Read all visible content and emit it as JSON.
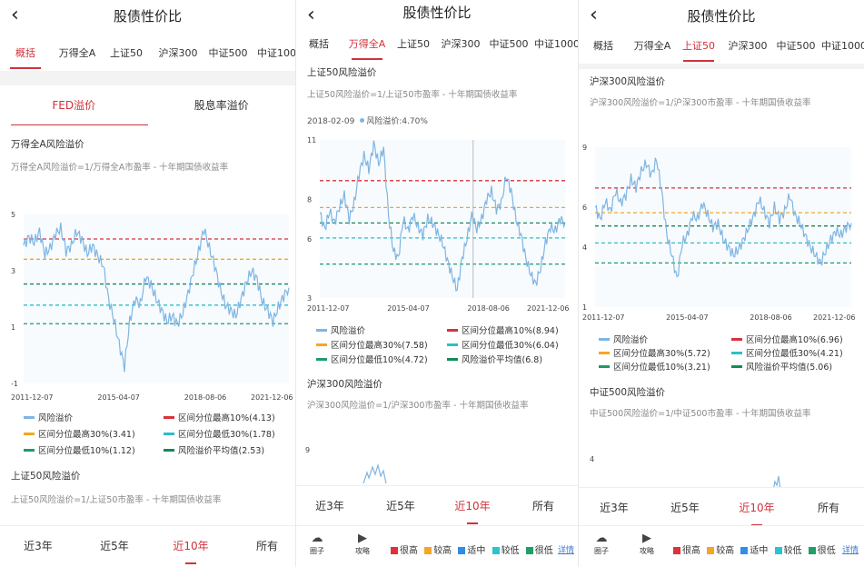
{
  "colors": {
    "accent": "#d0323c",
    "series": "#7fb5e3",
    "line_max10": "#d9323c",
    "line_max30": "#f5a623",
    "line_min30": "#2bbfc6",
    "line_min10": "#1f9a6b",
    "line_avg": "#138a5a",
    "level_very_high": "#e0303c",
    "level_high": "#f5a623",
    "level_mid": "#2f8ee6",
    "level_low": "#29c4cc",
    "level_very_low": "#1fa065",
    "link": "#3a78d6"
  },
  "header": {
    "back_icon": "chevron-left-icon",
    "title": "股债性价比"
  },
  "tabs": [
    "概括",
    "万得全A",
    "上证50",
    "沪深300",
    "中证500",
    "中证1000"
  ],
  "range_tabs": [
    "近3年",
    "近5年",
    "近10年",
    "所有"
  ],
  "panel1": {
    "active_tab": "概括",
    "subtabs": [
      "FED溢价",
      "股息率溢价"
    ],
    "section_title": "万得全A风险溢价",
    "formula": "万得全A风险溢价=1/万得全A市盈率 - 十年期国债收益率",
    "legend": [
      "风险溢价",
      "区间分位最高10%(4.13)",
      "区间分位最高30%(3.41)",
      "区间分位最低30%(1.78)",
      "区间分位最低10%(1.12)",
      "风险溢价平均值(2.53)"
    ],
    "next_section_title": "上证50风险溢价",
    "next_formula": "上证50风险溢价=1/上证50市盈率 - 十年期国债收益率",
    "active_range": "近10年"
  },
  "panel2": {
    "active_tab": "万得全A",
    "section_title": "上证50风险溢价",
    "formula": "上证50风险溢价=1/上证50市盈率 - 十年期国债收益率",
    "tooltip_date": "2018-02-09",
    "tooltip_value": "风险溢价:4.70%",
    "legend": [
      "风险溢价",
      "区间分位最高10%(8.94)",
      "区间分位最高30%(7.58)",
      "区间分位最低30%(6.04)",
      "区间分位最低10%(4.72)",
      "风险溢价平均值(6.8)"
    ],
    "next_section_title": "沪深300风险溢价",
    "next_formula": "沪深300风险溢价=1/沪深300市盈率 - 十年期国债收益率",
    "active_range": "近10年"
  },
  "panel3": {
    "active_tab": "上证50",
    "section_title": "沪深300风险溢价",
    "formula": "沪深300风险溢价=1/沪深300市盈率 - 十年期国债收益率",
    "legend": [
      "风险溢价",
      "区间分位最高10%(6.96)",
      "区间分位最高30%(5.72)",
      "区间分位最低30%(4.21)",
      "区间分位最低10%(3.21)",
      "风险溢价平均值(5.06)"
    ],
    "next_section_title": "中证500风险溢价",
    "next_formula": "中证500风险溢价=1/中证500市盈率 - 十年期国债收益率",
    "active_range": "近10年"
  },
  "footer": {
    "circle_label": "圈子",
    "circle_icon": "chat-bubble-icon",
    "guide_label": "攻略",
    "guide_icon": "play-circle-icon",
    "levels": [
      "很高",
      "较高",
      "适中",
      "较低",
      "很低"
    ],
    "detail": "详情"
  },
  "chart_data": [
    {
      "type": "line",
      "title": "万得全A风险溢价",
      "x_ticks": [
        "2011-12-07",
        "2015-04-07",
        "2018-08-06",
        "2021-12-06"
      ],
      "y_ticks": [
        5,
        3,
        1,
        -1
      ],
      "ylim": [
        -1,
        5
      ],
      "grid": false,
      "legend_position": "bottom",
      "series": [
        {
          "name": "风险溢价",
          "values": [
            3.9,
            4.2,
            4.0,
            4.4,
            3.6,
            3.8,
            4.3,
            4.5,
            3.7,
            3.9,
            4.4,
            4.1,
            3.6,
            3.9,
            3.5,
            3.2,
            2.0,
            1.3,
            0.4,
            -0.4,
            1.2,
            2.0,
            1.8,
            2.8,
            2.5,
            2.0,
            1.6,
            1.2,
            1.4,
            1.1,
            1.5,
            2.2,
            3.0,
            3.7,
            4.5,
            3.8,
            3.2,
            2.4,
            1.8,
            1.6,
            1.4,
            2.0,
            2.6,
            3.0,
            2.7,
            1.9,
            1.6,
            1.2,
            1.7,
            2.1,
            2.4
          ]
        },
        {
          "name": "区间分位最高10%(4.13)",
          "values": [
            4.13
          ]
        },
        {
          "name": "区间分位最高30%(3.41)",
          "values": [
            3.41
          ]
        },
        {
          "name": "区间分位最低30%(1.78)",
          "values": [
            1.78
          ]
        },
        {
          "name": "区间分位最低10%(1.12)",
          "values": [
            1.12
          ]
        },
        {
          "name": "风险溢价平均值(2.53)",
          "values": [
            2.53
          ]
        }
      ]
    },
    {
      "type": "line",
      "title": "上证50风险溢价",
      "x_ticks": [
        "2011-12-07",
        "2015-04-07",
        "2018-08-06",
        "2021-12-06"
      ],
      "y_ticks": [
        11,
        8,
        6,
        3
      ],
      "ylim": [
        3,
        11
      ],
      "grid": false,
      "legend_position": "bottom",
      "series": [
        {
          "name": "风险溢价",
          "values": [
            7.3,
            6.5,
            7.4,
            6.8,
            7.6,
            8.2,
            7.0,
            7.8,
            9.3,
            10.2,
            9.5,
            10.8,
            9.8,
            10.6,
            7.2,
            5.4,
            5.0,
            7.0,
            6.4,
            7.2,
            6.6,
            6.2,
            7.0,
            6.8,
            6.3,
            5.8,
            4.9,
            4.1,
            3.4,
            5.0,
            6.0,
            7.2,
            6.5,
            7.0,
            8.0,
            8.4,
            7.5,
            7.8,
            9.2,
            8.4,
            7.0,
            6.2,
            5.0,
            4.2,
            3.7,
            4.5,
            5.8,
            6.6,
            6.4,
            7.0,
            6.8
          ]
        },
        {
          "name": "区间分位最高10%(8.94)",
          "values": [
            8.94
          ]
        },
        {
          "name": "区间分位最高30%(7.58)",
          "values": [
            7.58
          ]
        },
        {
          "name": "区间分位最低30%(6.04)",
          "values": [
            6.04
          ]
        },
        {
          "name": "区间分位最低10%(4.72)",
          "values": [
            4.72
          ]
        },
        {
          "name": "风险溢价平均值(6.8)",
          "values": [
            6.8
          ]
        }
      ]
    },
    {
      "type": "line",
      "title": "沪深300风险溢价",
      "x_ticks": [
        "2011-12-07",
        "2015-04-07",
        "2018-08-06",
        "2021-12-06"
      ],
      "y_ticks": [
        9,
        6,
        4,
        1
      ],
      "ylim": [
        1,
        9
      ],
      "grid": false,
      "legend_position": "bottom",
      "series": [
        {
          "name": "风险溢价",
          "values": [
            6.0,
            5.4,
            6.3,
            5.8,
            6.8,
            6.2,
            6.6,
            7.4,
            7.0,
            7.8,
            8.2,
            7.6,
            8.4,
            6.8,
            4.6,
            3.6,
            2.4,
            4.2,
            4.6,
            5.6,
            5.4,
            6.2,
            5.6,
            5.0,
            5.2,
            4.4,
            4.0,
            3.6,
            3.9,
            4.4,
            5.0,
            5.6,
            6.4,
            5.8,
            5.2,
            6.0,
            5.4,
            5.8,
            6.6,
            5.6,
            5.2,
            4.6,
            4.0,
            3.6,
            3.2,
            3.8,
            4.4,
            4.8,
            4.6,
            5.0,
            5.2
          ]
        },
        {
          "name": "区间分位最高10%(6.96)",
          "values": [
            6.96
          ]
        },
        {
          "name": "区间分位最高30%(5.72)",
          "values": [
            5.72
          ]
        },
        {
          "name": "区间分位最低30%(4.21)",
          "values": [
            4.21
          ]
        },
        {
          "name": "区间分位最低10%(3.21)",
          "values": [
            3.21
          ]
        },
        {
          "name": "风险溢价平均值(5.06)",
          "values": [
            5.06
          ]
        }
      ]
    },
    {
      "type": "line",
      "title": "中证500风险溢价",
      "y_ticks": [
        4
      ],
      "series": []
    }
  ]
}
